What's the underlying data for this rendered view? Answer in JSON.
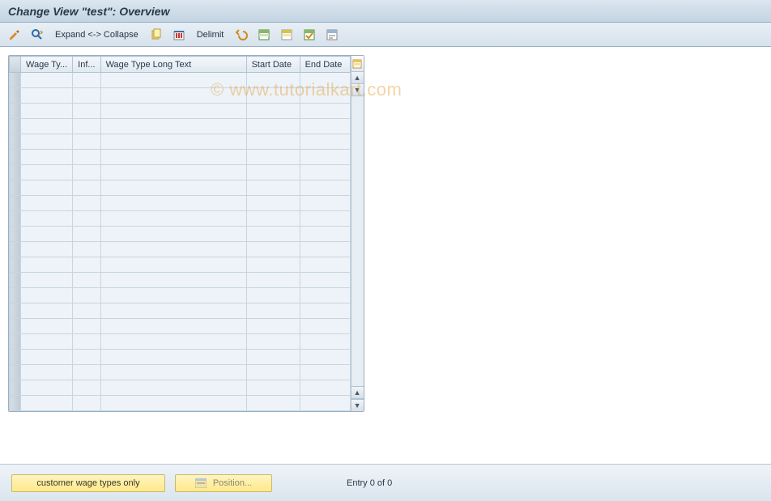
{
  "title": "Change View \"test\": Overview",
  "watermark": "© www.tutorialkart.com",
  "toolbar": {
    "expand_collapse": "Expand <-> Collapse",
    "delimit": "Delimit"
  },
  "columns": {
    "wage_type": "Wage Ty...",
    "inf": "Inf...",
    "long_text": "Wage Type Long Text",
    "start_date": "Start Date",
    "end_date": "End Date"
  },
  "rows": [
    {
      "wage_type": "",
      "inf": "",
      "long_text": "",
      "start_date": "",
      "end_date": ""
    },
    {
      "wage_type": "",
      "inf": "",
      "long_text": "",
      "start_date": "",
      "end_date": ""
    },
    {
      "wage_type": "",
      "inf": "",
      "long_text": "",
      "start_date": "",
      "end_date": ""
    },
    {
      "wage_type": "",
      "inf": "",
      "long_text": "",
      "start_date": "",
      "end_date": ""
    },
    {
      "wage_type": "",
      "inf": "",
      "long_text": "",
      "start_date": "",
      "end_date": ""
    },
    {
      "wage_type": "",
      "inf": "",
      "long_text": "",
      "start_date": "",
      "end_date": ""
    },
    {
      "wage_type": "",
      "inf": "",
      "long_text": "",
      "start_date": "",
      "end_date": ""
    },
    {
      "wage_type": "",
      "inf": "",
      "long_text": "",
      "start_date": "",
      "end_date": ""
    },
    {
      "wage_type": "",
      "inf": "",
      "long_text": "",
      "start_date": "",
      "end_date": ""
    },
    {
      "wage_type": "",
      "inf": "",
      "long_text": "",
      "start_date": "",
      "end_date": ""
    },
    {
      "wage_type": "",
      "inf": "",
      "long_text": "",
      "start_date": "",
      "end_date": ""
    },
    {
      "wage_type": "",
      "inf": "",
      "long_text": "",
      "start_date": "",
      "end_date": ""
    },
    {
      "wage_type": "",
      "inf": "",
      "long_text": "",
      "start_date": "",
      "end_date": ""
    },
    {
      "wage_type": "",
      "inf": "",
      "long_text": "",
      "start_date": "",
      "end_date": ""
    },
    {
      "wage_type": "",
      "inf": "",
      "long_text": "",
      "start_date": "",
      "end_date": ""
    },
    {
      "wage_type": "",
      "inf": "",
      "long_text": "",
      "start_date": "",
      "end_date": ""
    },
    {
      "wage_type": "",
      "inf": "",
      "long_text": "",
      "start_date": "",
      "end_date": ""
    },
    {
      "wage_type": "",
      "inf": "",
      "long_text": "",
      "start_date": "",
      "end_date": ""
    },
    {
      "wage_type": "",
      "inf": "",
      "long_text": "",
      "start_date": "",
      "end_date": ""
    },
    {
      "wage_type": "",
      "inf": "",
      "long_text": "",
      "start_date": "",
      "end_date": ""
    },
    {
      "wage_type": "",
      "inf": "",
      "long_text": "",
      "start_date": "",
      "end_date": ""
    },
    {
      "wage_type": "",
      "inf": "",
      "long_text": "",
      "start_date": "",
      "end_date": ""
    }
  ],
  "footer": {
    "customer_btn": "customer wage types only",
    "position_btn": "Position...",
    "entry_text": "Entry 0 of 0"
  }
}
